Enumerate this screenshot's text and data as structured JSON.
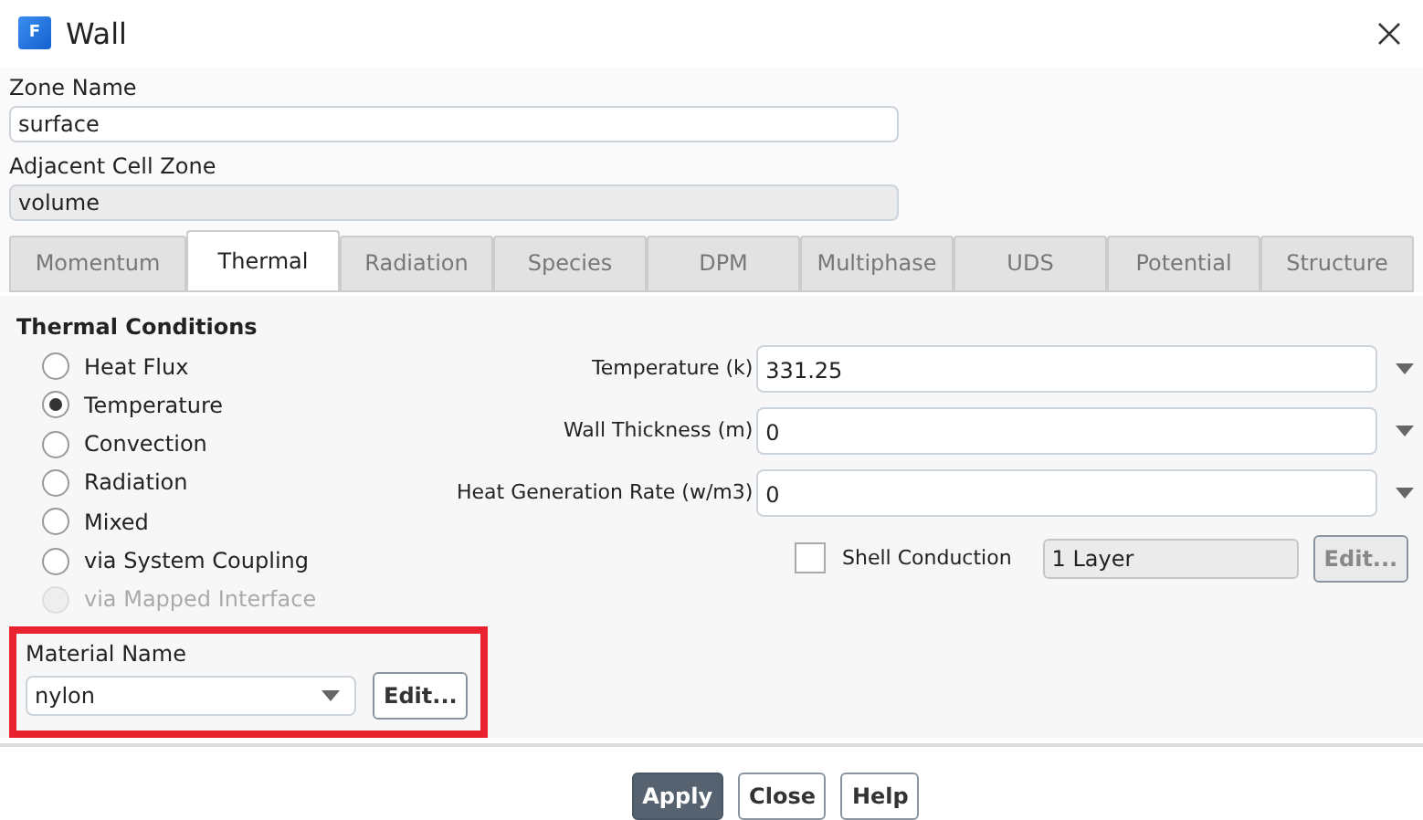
{
  "window": {
    "title": "Wall",
    "app_icon": "F"
  },
  "zone_name": {
    "label": "Zone Name",
    "value": "surface"
  },
  "adjacent_cell_zone": {
    "label": "Adjacent Cell Zone",
    "value": "volume",
    "disabled": true
  },
  "tabs": [
    {
      "label": "Momentum",
      "selected": false
    },
    {
      "label": "Thermal",
      "selected": true
    },
    {
      "label": "Radiation",
      "selected": false
    },
    {
      "label": "Species",
      "selected": false
    },
    {
      "label": "DPM",
      "selected": false
    },
    {
      "label": "Multiphase",
      "selected": false
    },
    {
      "label": "UDS",
      "selected": false
    },
    {
      "label": "Potential",
      "selected": false
    },
    {
      "label": "Structure",
      "selected": false
    }
  ],
  "thermal_conditions": {
    "title": "Thermal Conditions",
    "options": [
      {
        "label": "Heat Flux",
        "selected": false,
        "disabled": false
      },
      {
        "label": "Temperature",
        "selected": true,
        "disabled": false
      },
      {
        "label": "Convection",
        "selected": false,
        "disabled": false
      },
      {
        "label": "Radiation",
        "selected": false,
        "disabled": false
      },
      {
        "label": "Mixed",
        "selected": false,
        "disabled": false
      },
      {
        "label": "via System Coupling",
        "selected": false,
        "disabled": false
      },
      {
        "label": "via Mapped Interface",
        "selected": false,
        "disabled": true
      }
    ]
  },
  "parameters": [
    {
      "label": "Temperature (k)",
      "value": "331.25"
    },
    {
      "label": "Wall Thickness (m)",
      "value": "0"
    },
    {
      "label": "Heat Generation Rate (w/m3)",
      "value": "0"
    }
  ],
  "shell_conduction": {
    "label": "Shell Conduction",
    "checked": false,
    "layers": "1 Layer",
    "edit": "Edit...",
    "disabled": true
  },
  "material": {
    "label": "Material Name",
    "value": "nylon",
    "edit": "Edit...",
    "highlighted": true
  },
  "buttons": [
    {
      "label": "Apply",
      "primary": true
    },
    {
      "label": "Close",
      "primary": false
    },
    {
      "label": "Help",
      "primary": false
    }
  ]
}
